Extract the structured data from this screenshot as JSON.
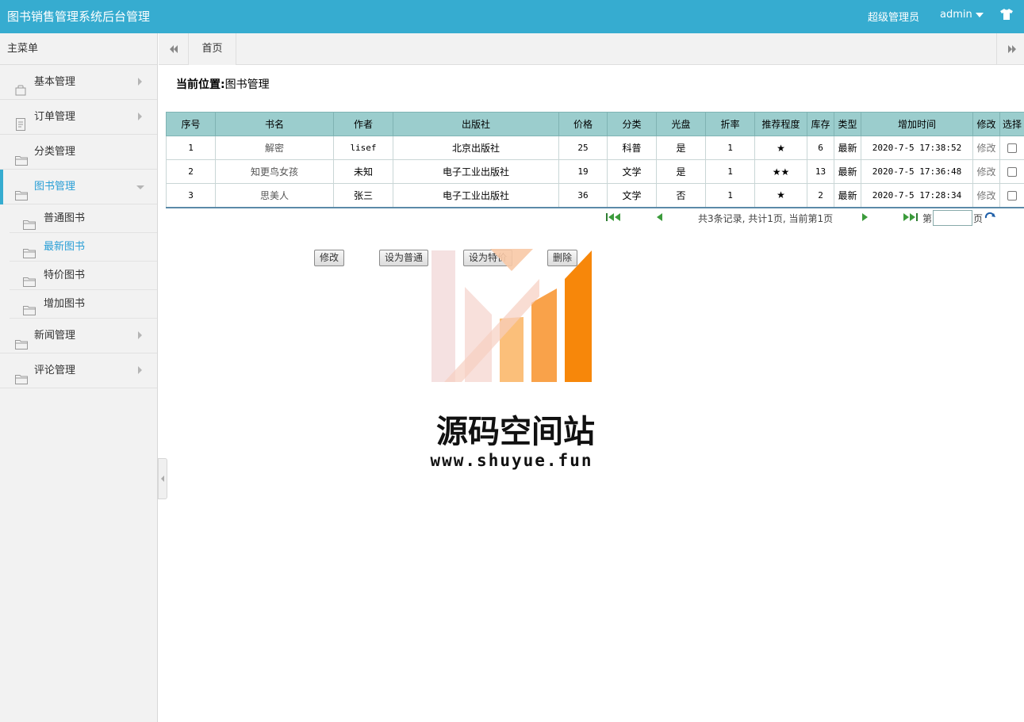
{
  "header": {
    "app_title": "图书销售管理系统后台管理",
    "role": "超级管理员",
    "username": "admin"
  },
  "sidebar": {
    "title": "主菜单",
    "items": [
      {
        "label": "基本管理",
        "icon": "bag-icon"
      },
      {
        "label": "订单管理",
        "icon": "document-icon"
      },
      {
        "label": "分类管理",
        "icon": "folder-icon"
      },
      {
        "label": "图书管理",
        "icon": "folder-icon"
      },
      {
        "label": "新闻管理",
        "icon": "folder-icon"
      },
      {
        "label": "评论管理",
        "icon": "folder-icon"
      }
    ],
    "sub_items": [
      {
        "label": "普通图书"
      },
      {
        "label": "最新图书"
      },
      {
        "label": "特价图书"
      },
      {
        "label": "增加图书"
      }
    ]
  },
  "tabs": {
    "home": "首页"
  },
  "breadcrumb": {
    "prefix": "当前位置:",
    "current": "图书管理"
  },
  "table": {
    "headers": [
      "序号",
      "书名",
      "作者",
      "出版社",
      "价格",
      "分类",
      "光盘",
      "折率",
      "推荐程度",
      "库存",
      "类型",
      "增加时间",
      "修改",
      "选择"
    ],
    "rows": [
      {
        "no": "1",
        "title": "解密",
        "author": "lisef",
        "publisher": "北京出版社",
        "price": "25",
        "category": "科普",
        "cd": "是",
        "discount": "1",
        "stars": "★",
        "stock": "6",
        "type": "最新",
        "time": "2020-7-5 17:38:52",
        "edit": "修改"
      },
      {
        "no": "2",
        "title": "知更鸟女孩",
        "author": "未知",
        "publisher": "电子工业出版社",
        "price": "19",
        "category": "文学",
        "cd": "是",
        "discount": "1",
        "stars": "★★",
        "stock": "13",
        "type": "最新",
        "time": "2020-7-5 17:36:48",
        "edit": "修改"
      },
      {
        "no": "3",
        "title": "思美人",
        "author": "张三",
        "publisher": "电子工业出版社",
        "price": "36",
        "category": "文学",
        "cd": "否",
        "discount": "1",
        "stars": "★",
        "stock": "2",
        "type": "最新",
        "time": "2020-7-5 17:28:34",
        "edit": "修改"
      }
    ]
  },
  "pager": {
    "info": "共3条记录, 共计1页, 当前第1页",
    "page_prefix": "第",
    "page_suffix": "页"
  },
  "actions": {
    "edit": "修改",
    "set_normal": "设为普通",
    "set_special": "设为特价",
    "delete": "删除"
  },
  "watermark": {
    "name": "源码空间站",
    "url": "www.shuyue.fun"
  },
  "colors": {
    "header_bg": "#36acd0",
    "accent": "#2a9fd6",
    "table_header": "#9bcdcd"
  }
}
